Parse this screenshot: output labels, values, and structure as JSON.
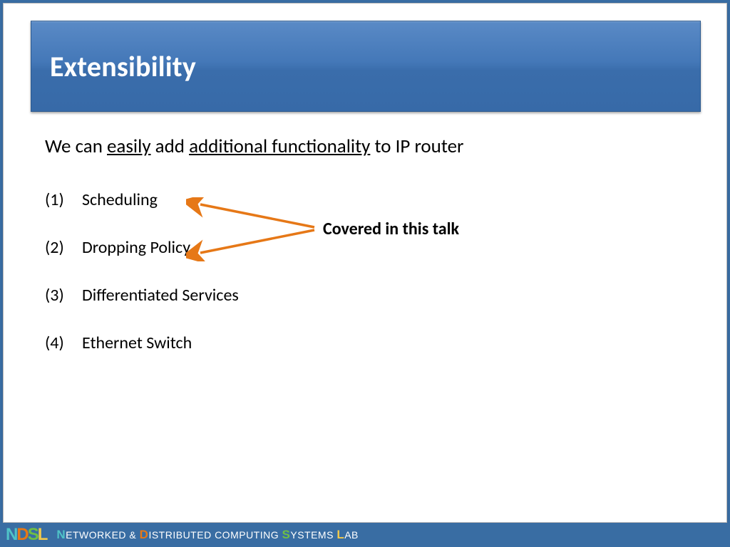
{
  "title": "Extensibility",
  "lead": {
    "pre": "We can ",
    "u1": "easily",
    "mid": " add ",
    "u2": "additional functionality",
    "post": " to IP router"
  },
  "items": [
    {
      "num": "(1)",
      "text": "Scheduling"
    },
    {
      "num": "(2)",
      "text": "Dropping Policy"
    },
    {
      "num": "(3)",
      "text": "Differentiated Services"
    },
    {
      "num": "(4)",
      "text": "Ethernet Switch"
    }
  ],
  "annotation": "Covered in this talk",
  "arrow_color": "#e67817",
  "footer": {
    "logo": {
      "n": "N",
      "d": "D",
      "s": "S",
      "l": "L"
    },
    "name": {
      "n": "N",
      "etworked": "ETWORKED",
      "amp": " & ",
      "d": "D",
      "istributed": "ISTRIBUTED COMPUTING ",
      "s": "S",
      "ystems": "YSTEMS ",
      "l": "L",
      "ab": "AB"
    }
  }
}
